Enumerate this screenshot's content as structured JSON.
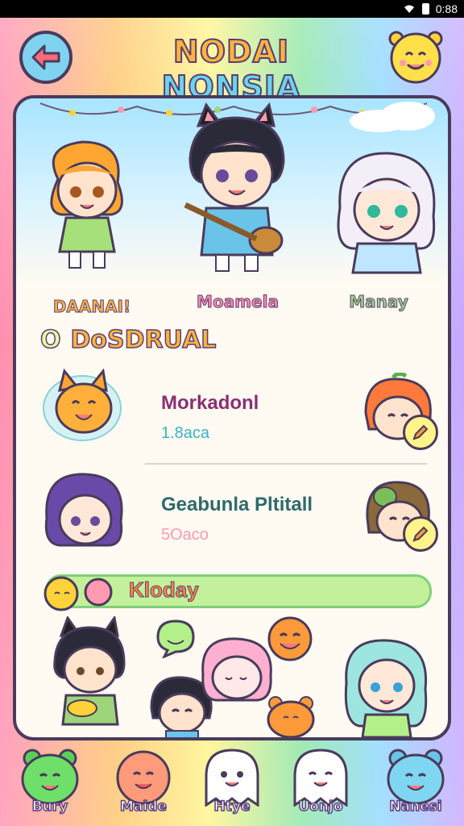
{
  "status": {
    "time": "0:88"
  },
  "header": {
    "title_part1": "NODAI ",
    "title_part2": "NONSIA"
  },
  "featured": [
    {
      "name": "DAANAI!",
      "color": "#ffb43a"
    },
    {
      "name": "Moamela",
      "color": "#ff8aa6"
    },
    {
      "name": "Manay",
      "color": "#9ed57a"
    }
  ],
  "section": {
    "prefix": "O",
    "title": "DoSDRUAL"
  },
  "list": [
    {
      "name": "Morkadonl",
      "sub": "1.8aca",
      "sub_color": "#3bb0c8"
    },
    {
      "name": "Geabunla Pltitall",
      "sub": "5Oaco",
      "sub_color": "#ff9ab0"
    }
  ],
  "today": {
    "label": "Kloday"
  },
  "nav": [
    {
      "label": "Bury"
    },
    {
      "label": "Maide"
    },
    {
      "label": "Htye"
    },
    {
      "label": "Uonjo"
    },
    {
      "label": "Nanesi"
    }
  ],
  "colors": {
    "outline": "#4a3b5c",
    "accent": "#ffb43a",
    "card": "#fffaf2"
  }
}
